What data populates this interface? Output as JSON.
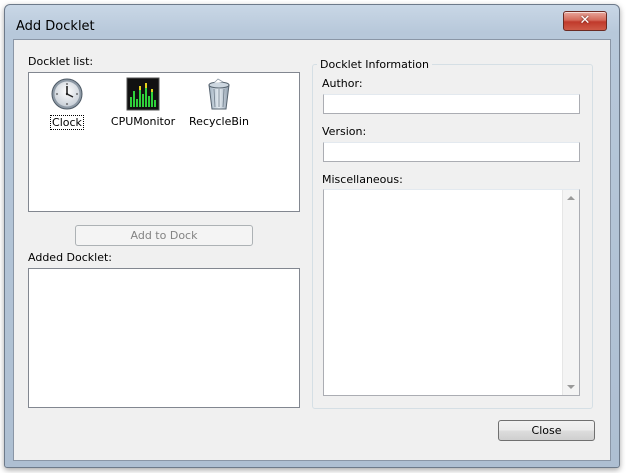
{
  "window": {
    "title": "Add Docklet"
  },
  "left": {
    "docklet_list_label": "Docklet list:",
    "docklets": [
      {
        "label": "Clock",
        "icon": "clock-icon",
        "selected": true
      },
      {
        "label": "CPUMonitor",
        "icon": "cpu-monitor-icon",
        "selected": false
      },
      {
        "label": "RecycleBin",
        "icon": "recycle-bin-icon",
        "selected": false
      }
    ],
    "add_button_label": "Add to Dock",
    "added_docklet_label": "Added Docklet:"
  },
  "right": {
    "group_title": "Docklet Information",
    "author_label": "Author:",
    "author_value": "",
    "version_label": "Version:",
    "version_value": "",
    "misc_label": "Miscellaneous:",
    "misc_value": ""
  },
  "footer": {
    "close_label": "Close"
  },
  "colors": {
    "title_close_red": "#c0392b",
    "client_bg": "#f0f0f0",
    "field_border": "#abadb3"
  }
}
